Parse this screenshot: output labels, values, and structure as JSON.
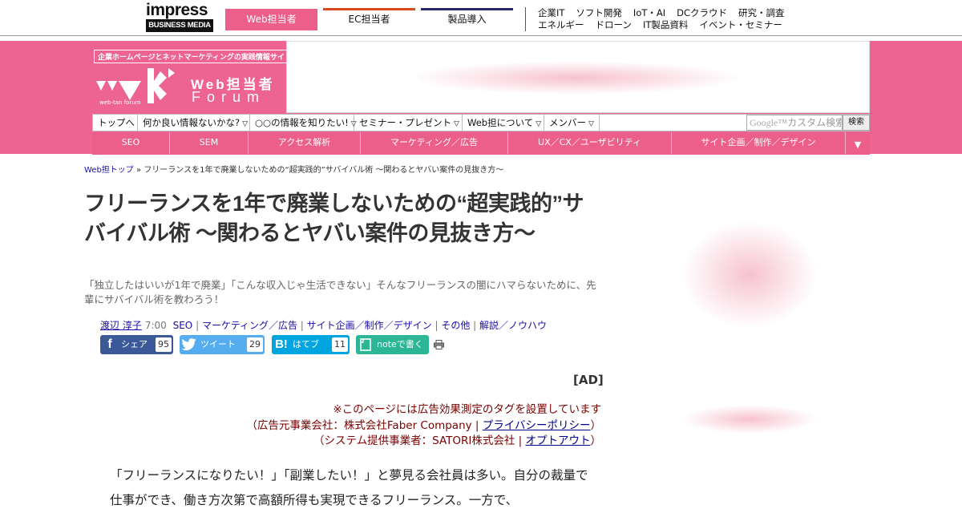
{
  "header": {
    "impress_word": "impress",
    "impress_sub": "BUSINESS MEDIA",
    "site_tabs": [
      {
        "label": "Web担当者",
        "color": "#ec5f8b"
      },
      {
        "label": "EC担当者",
        "color": "#d94a1f"
      },
      {
        "label": "製品導入",
        "color": "#27286e"
      }
    ],
    "links_row1": [
      "企業IT",
      "ソフト開発",
      "IoT・AI",
      "DCクラウド",
      "研究・調査"
    ],
    "links_row2": [
      "エネルギー",
      "ドローン",
      "IT製品資料",
      "イベント・セミナー"
    ]
  },
  "brand": {
    "tagline": "企業ホームページとネットマーケティングの実践情報サイト",
    "webtan": "web-tan forum",
    "title": "Web担当者",
    "forum": "Forum",
    "accent": "#ed6391"
  },
  "nav": {
    "items": [
      {
        "label": "トップへ",
        "dropdown": false
      },
      {
        "label": "何か良い情報ないかな?",
        "dropdown": true
      },
      {
        "label": "○○の情報を知りたい!",
        "dropdown": true
      },
      {
        "label": "セミナー・プレゼント",
        "dropdown": true
      },
      {
        "label": "Web担について",
        "dropdown": true
      },
      {
        "label": "メンバー",
        "dropdown": true
      }
    ],
    "search_placeholder_brand": "Google™",
    "search_placeholder": "カスタム検索",
    "search_button": "検索"
  },
  "categories": [
    "SEO",
    "SEM",
    "アクセス解析",
    "マーケティング／広告",
    "UX／CX／ユーザビリティ",
    "サイト企画／制作／デザイン"
  ],
  "breadcrumb": {
    "home": "Web担トップ",
    "sep": "»",
    "current": "フリーランスを1年で廃業しないための“超実践的”サバイバル術 ～関わるとヤバい案件の見抜き方～"
  },
  "article": {
    "title": "フリーランスを1年で廃業しないための“超実践的”サバイバル術 ～関わるとヤバい案件の見抜き方～",
    "lead": "「独立したはいいが1年で廃業」「こんな収入じゃ生活できない」そんなフリーランスの闇にハマらないために、先輩にサバイバル術を教わろう！",
    "author": "渡辺 淳子",
    "time": "7:00",
    "tags": [
      "SEO",
      "マーケティング／広告",
      "サイト企画／制作／デザイン",
      "その他",
      "解説／ノウハウ"
    ],
    "ad_label": "[AD]",
    "notice_line1": "※このページには広告効果測定のタグを設置しています",
    "notice_line2_prefix": "（広告元事業会社：株式会社Faber Company | ",
    "notice_line2_link": "プライバシーポリシー",
    "notice_line2_suffix": "）",
    "notice_line3_prefix": "（システム提供事業者：SATORI株式会社 | ",
    "notice_line3_link": "オプトアウト",
    "notice_line3_suffix": "）",
    "body": "「フリーランスになりたい！」「副業したい！」と夢見る会社員は多い。自分の裁量で仕事ができ、働き方次第で高額所得も実現できるフリーランス。一方で、"
  },
  "share": [
    {
      "label": "シェア",
      "icon": "f",
      "count": "95",
      "color": "#3b5998"
    },
    {
      "label": "ツイート",
      "icon": "t",
      "count": "29",
      "color": "#55acee"
    },
    {
      "label": "はてブ",
      "icon": "B!",
      "count": "11",
      "color": "#00a4de"
    },
    {
      "label": "noteで書く",
      "icon": "n",
      "color": "#2cb696"
    }
  ]
}
